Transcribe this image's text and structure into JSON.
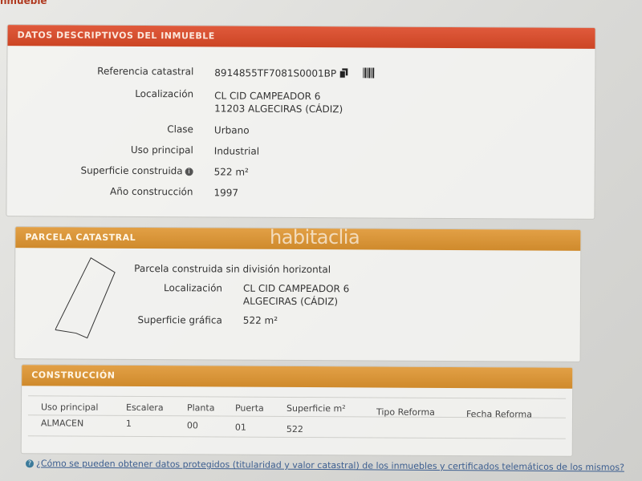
{
  "top_partial": "nmueble",
  "descriptivos": {
    "title": "DATOS DESCRIPTIVOS DEL INMUEBLE",
    "rows": [
      {
        "label": "Referencia catastral",
        "value": "8914855TF7081S0001BP"
      },
      {
        "label": "Localización",
        "value": "CL CID CAMPEADOR 6",
        "value2": "11203 ALGECIRAS (CÁDIZ)"
      },
      {
        "label": "Clase",
        "value": "Urbano"
      },
      {
        "label": "Uso principal",
        "value": "Industrial"
      },
      {
        "label": "Superficie construida",
        "value": "522 m²"
      },
      {
        "label": "Año construcción",
        "value": "1997"
      }
    ]
  },
  "parcela": {
    "title": "PARCELA CATASTRAL",
    "subtitle": "Parcela construida sin división horizontal",
    "loc_label": "Localización",
    "loc_value1": "CL CID CAMPEADOR 6",
    "loc_value2": "ALGECIRAS (CÁDIZ)",
    "sup_label": "Superficie gráfica",
    "sup_value": "522 m²"
  },
  "construccion": {
    "title": "CONSTRUCCIÓN",
    "headers": [
      "Uso principal",
      "Escalera",
      "Planta",
      "Puerta",
      "Superficie m²",
      "Tipo Reforma",
      "Fecha Reforma"
    ],
    "row": [
      "ALMACEN",
      "1",
      "00",
      "01",
      "522",
      "",
      ""
    ]
  },
  "watermark": "habitaclia",
  "footer_link": "¿Cómo se pueden obtener datos protegidos (titularidad y valor catastral) de los inmuebles y certificados telemáticos de los mismos?",
  "colors": {
    "header_red": "#d44d2c",
    "header_orange": "#d8932f"
  }
}
